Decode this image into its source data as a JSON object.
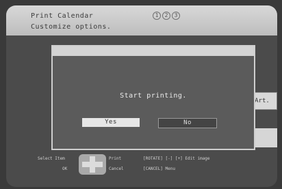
{
  "header": {
    "title": "Print Calendar",
    "subtitle": "Customize options.",
    "steps": [
      "1",
      "2",
      "3"
    ]
  },
  "side": {
    "art_label": "Art."
  },
  "dialog": {
    "message": "Start printing.",
    "yes_label": "Yes",
    "no_label": "No"
  },
  "guide": {
    "select_item": "Select Item",
    "print": "Print",
    "ok": "OK",
    "cancel": "Cancel",
    "rotate_edit": "[ROTATE] [-] [+] Edit image",
    "cancel_menu": "[CANCEL] Menu"
  },
  "icons": {
    "dpad": "dpad-icon",
    "step": "step-circle-icon"
  }
}
